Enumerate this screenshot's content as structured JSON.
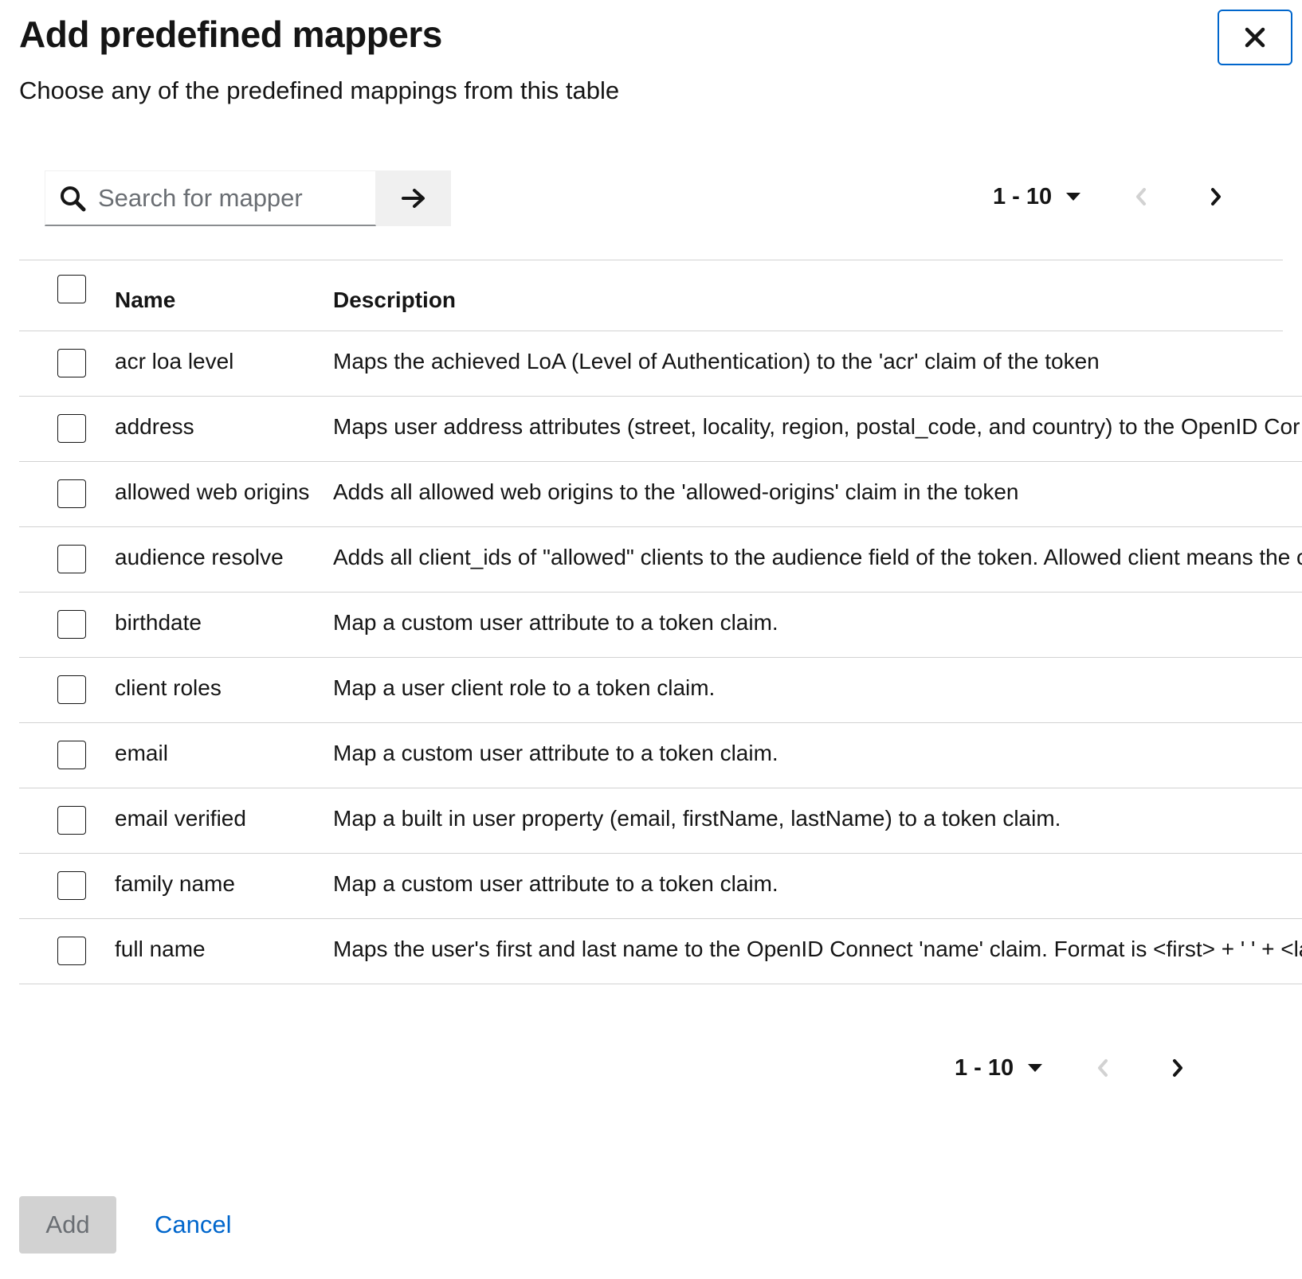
{
  "modal": {
    "title": "Add predefined mappers",
    "subtitle": "Choose any of the predefined mappings from this table"
  },
  "search": {
    "placeholder": "Search for mapper",
    "value": ""
  },
  "pagination": {
    "range": "1 - 10"
  },
  "table": {
    "columns": [
      "Name",
      "Description"
    ],
    "rows": [
      {
        "name": "acr loa level",
        "description": "Maps the achieved LoA (Level of Authentication) to the 'acr' claim of the token"
      },
      {
        "name": "address",
        "description": "Maps user address attributes (street, locality, region, postal_code, and country) to the OpenID Cor"
      },
      {
        "name": "allowed web origins",
        "description": "Adds all allowed web origins to the 'allowed-origins' claim in the token"
      },
      {
        "name": "audience resolve",
        "description": "Adds all client_ids of \"allowed\" clients to the audience field of the token. Allowed client means the c"
      },
      {
        "name": "birthdate",
        "description": "Map a custom user attribute to a token claim."
      },
      {
        "name": "client roles",
        "description": "Map a user client role to a token claim."
      },
      {
        "name": "email",
        "description": "Map a custom user attribute to a token claim."
      },
      {
        "name": "email verified",
        "description": "Map a built in user property (email, firstName, lastName) to a token claim."
      },
      {
        "name": "family name",
        "description": "Map a custom user attribute to a token claim."
      },
      {
        "name": "full name",
        "description": "Maps the user's first and last name to the OpenID Connect 'name' claim. Format is <first> + ' ' + <las"
      }
    ]
  },
  "footer": {
    "add_label": "Add",
    "cancel_label": "Cancel"
  },
  "colors": {
    "primary": "#0066cc",
    "text": "#151515",
    "muted": "#6a6e73",
    "border": "#d2d2d2",
    "disabled_bg": "#d2d2d2"
  },
  "icons": {
    "close": "close-icon",
    "search": "search-icon",
    "go": "arrow-right-icon",
    "caret": "caret-down-icon",
    "prev": "angle-left-icon",
    "next": "angle-right-icon"
  }
}
